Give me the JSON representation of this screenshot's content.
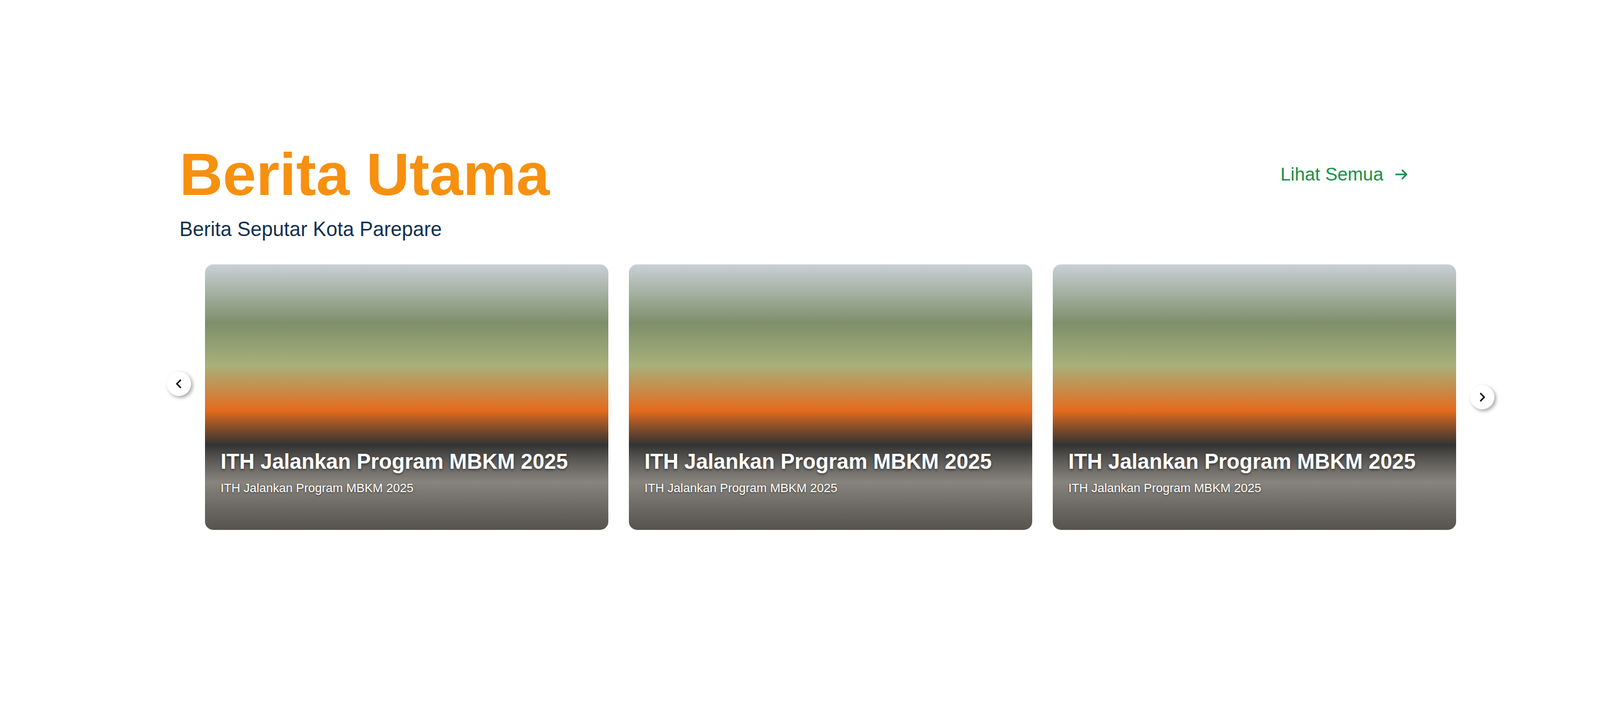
{
  "title": "Berita Utama",
  "subtitle": "Berita Seputar Kota Parepare",
  "see_all": {
    "label": "Lihat Semua"
  },
  "cards": [
    {
      "title": "ITH Jalankan Program MBKM 2025",
      "caption": "ITH Jalankan Program MBKM 2025"
    },
    {
      "title": "ITH Jalankan Program MBKM 2025",
      "caption": "ITH Jalankan Program MBKM 2025"
    },
    {
      "title": "ITH Jalankan Program MBKM 2025",
      "caption": "ITH Jalankan Program MBKM 2025"
    }
  ]
}
